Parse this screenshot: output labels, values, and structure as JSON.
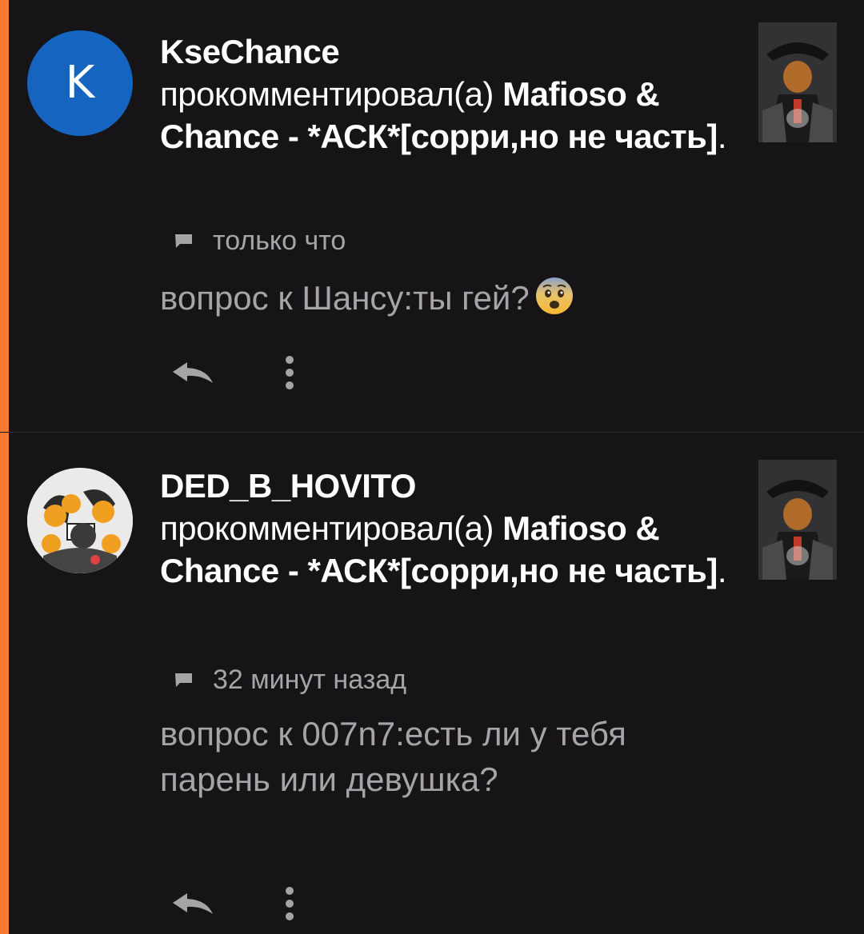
{
  "colors": {
    "background": "#161417",
    "unread_accent": "#fa7a35",
    "avatar_letter_bg": "#1565c0",
    "muted_text": "#a7a4a8"
  },
  "notifications": [
    {
      "avatar_letter": "K",
      "username": "KseChance",
      "action_text": "прокомментировал(а)",
      "post_title": "Mafioso & Chance - *АСК*[сорри,но не часть]",
      "trailing_punct": ".",
      "timestamp": "только что",
      "comment_text": "вопрос к Шансу:ты гей?",
      "emoji_icon": "fearful-face-emoji",
      "thumbnail_icon": "post-thumbnail-image",
      "unread": true
    },
    {
      "avatar_icon": "user-avatar-image",
      "username": "DED_B_HOVITO",
      "action_text": "прокомментировал(а)",
      "post_title": "Mafioso & Chance - *АСК*[сорри,но не часть]",
      "trailing_punct": ".",
      "timestamp": "32 минут назад",
      "comment_text": "вопрос к 007n7:есть ли у тебя парень или девушка?",
      "thumbnail_icon": "post-thumbnail-image",
      "unread": true
    }
  ],
  "icons": {
    "comment": "comment-icon",
    "reply": "reply-arrow-icon",
    "more": "more-vertical-icon"
  }
}
